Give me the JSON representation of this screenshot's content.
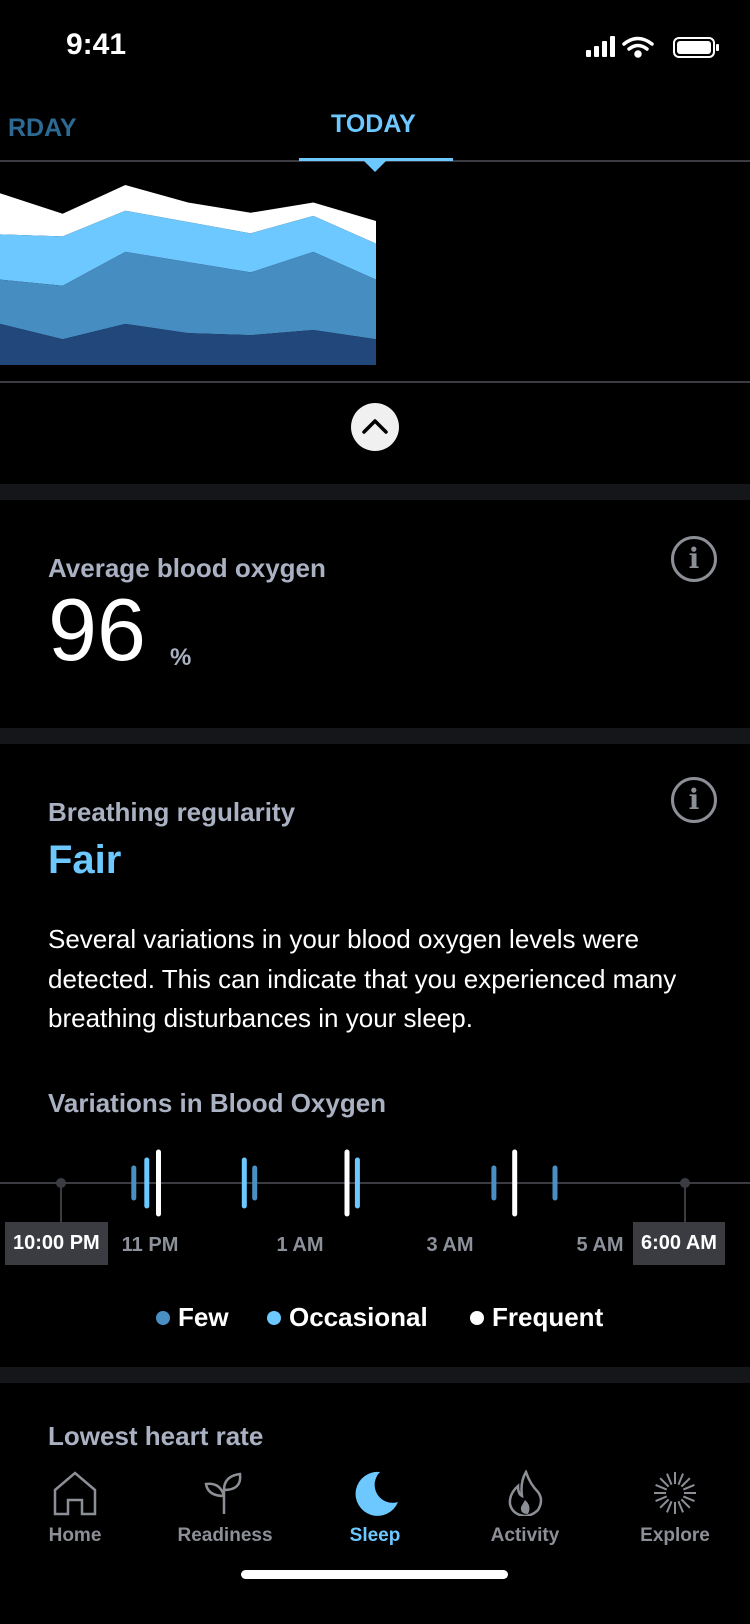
{
  "status_bar": {
    "time": "9:41"
  },
  "tabs": [
    {
      "label": "RDAY",
      "active": false
    },
    {
      "label": "TODAY",
      "active": true
    }
  ],
  "colors": {
    "accent": "#6cc8ff",
    "few": "#4a8fc4",
    "occasional": "#6cc8ff",
    "frequent": "#ffffff"
  },
  "chart_data": {
    "type": "area",
    "stacked": true,
    "x": [
      0,
      1,
      2,
      3,
      4,
      5,
      6
    ],
    "ylim": [
      0,
      175
    ],
    "series": [
      {
        "color": "#22477a",
        "values": [
          40,
          25,
          40,
          31,
          29,
          34,
          25
        ]
      },
      {
        "color": "#468dc1",
        "values": [
          43,
          52,
          70,
          69,
          61,
          76,
          58
        ]
      },
      {
        "color": "#6dc8ff",
        "values": [
          44,
          48,
          40,
          39,
          38,
          35,
          35
        ]
      },
      {
        "color": "#ffffff",
        "values": [
          40,
          22,
          25,
          19,
          20,
          13,
          22
        ]
      }
    ]
  },
  "collapse_icon": "chevron-up-icon",
  "blood_oxygen": {
    "label": "Average blood oxygen",
    "value": "96",
    "unit": "%",
    "info_icon": "i"
  },
  "breathing": {
    "label": "Breathing regularity",
    "status": "Fair",
    "info_icon": "i",
    "description": "Several variations in your blood oxygen levels were detected. This can indicate that you experienced many breathing disturbances in your sleep."
  },
  "variations": {
    "title": "Variations in Blood Oxygen",
    "start": "10:00 PM",
    "end": "6:00 AM",
    "ticks": [
      "11 PM",
      "1 AM",
      "3 AM",
      "5 AM"
    ],
    "events": [
      {
        "time": "22:56",
        "level": "few"
      },
      {
        "time": "23:06",
        "level": "occasional"
      },
      {
        "time": "23:15",
        "level": "frequent"
      },
      {
        "time": "00:21",
        "level": "occasional"
      },
      {
        "time": "00:29",
        "level": "few"
      },
      {
        "time": "01:40",
        "level": "frequent"
      },
      {
        "time": "01:48",
        "level": "occasional"
      },
      {
        "time": "03:33",
        "level": "few"
      },
      {
        "time": "03:49",
        "level": "frequent"
      },
      {
        "time": "04:20",
        "level": "few"
      }
    ],
    "legend": [
      "Few",
      "Occasional",
      "Frequent"
    ]
  },
  "next_section": {
    "label": "Lowest heart rate"
  },
  "nav": [
    {
      "label": "Home",
      "active": false
    },
    {
      "label": "Readiness",
      "active": false
    },
    {
      "label": "Sleep",
      "active": true
    },
    {
      "label": "Activity",
      "active": false
    },
    {
      "label": "Explore",
      "active": false
    }
  ]
}
